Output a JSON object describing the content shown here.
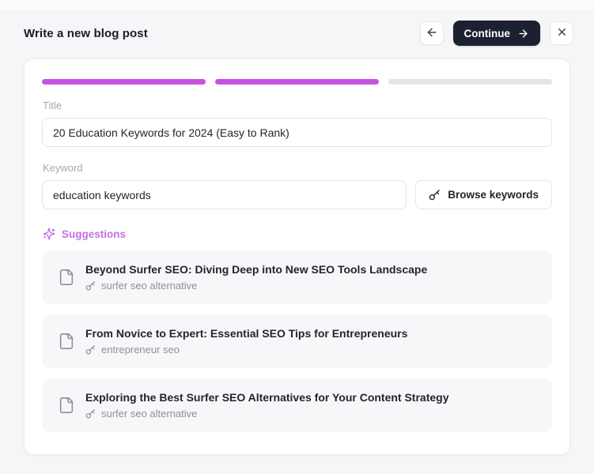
{
  "header": {
    "title": "Write a new blog post",
    "continue_label": "Continue"
  },
  "progress": {
    "segments_total": 3,
    "segments_complete": 2,
    "accent_color": "#c653e0",
    "track_color": "#e4e4e8"
  },
  "form": {
    "title_label": "Title",
    "title_value": "20 Education Keywords for 2024 (Easy to Rank)",
    "keyword_label": "Keyword",
    "keyword_value": "education keywords",
    "browse_button_label": "Browse keywords"
  },
  "suggestions": {
    "heading": "Suggestions",
    "items": [
      {
        "title": "Beyond Surfer SEO: Diving Deep into New SEO Tools Landscape",
        "keyword": "surfer seo alternative"
      },
      {
        "title": "From Novice to Expert: Essential SEO Tips for Entrepreneurs",
        "keyword": "entrepreneur seo"
      },
      {
        "title": "Exploring the Best Surfer SEO Alternatives for Your Content Strategy",
        "keyword": "surfer seo alternative"
      }
    ]
  }
}
